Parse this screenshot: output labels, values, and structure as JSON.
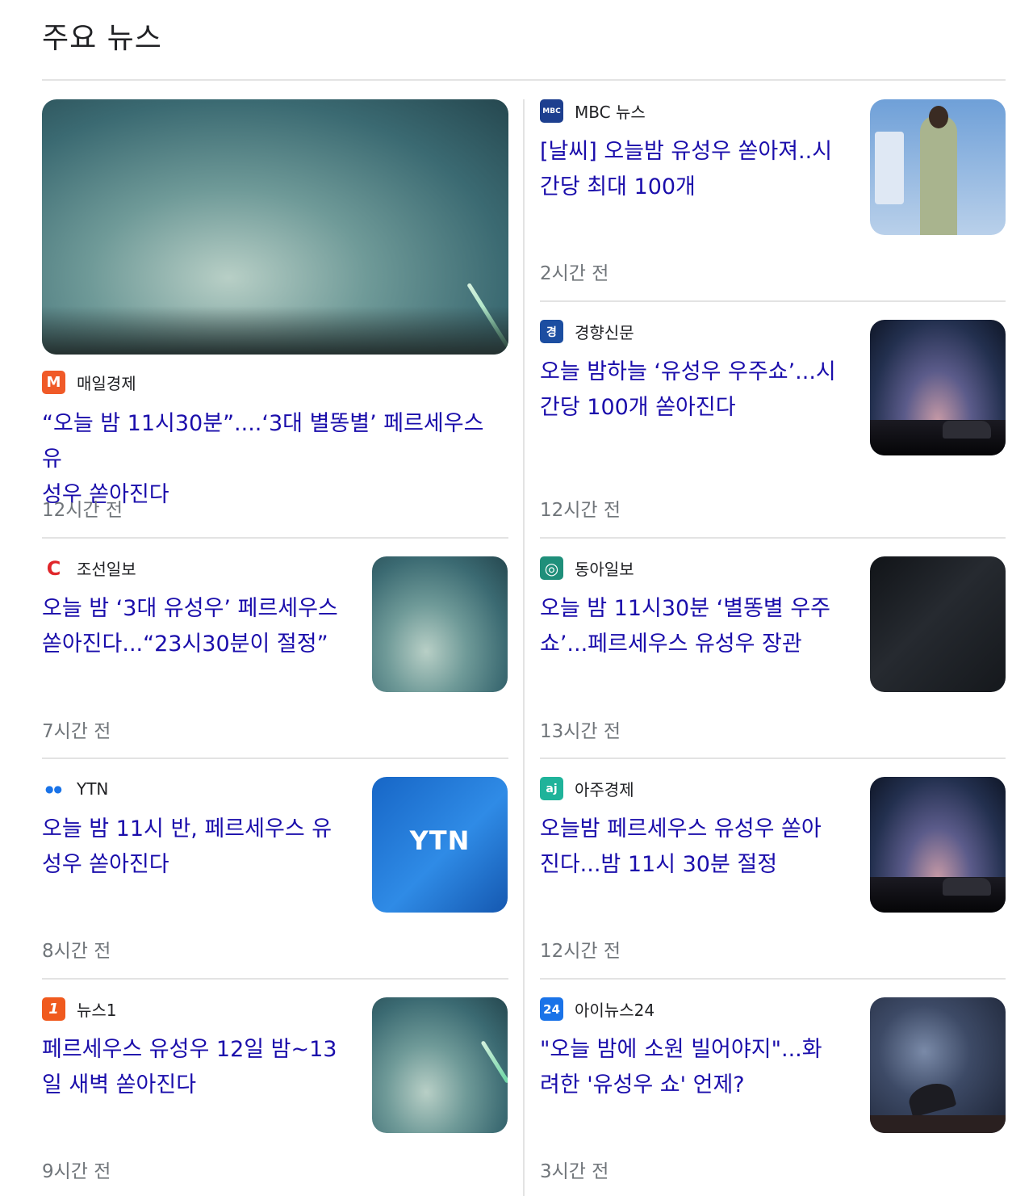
{
  "section": {
    "title": "주요 뉴스"
  },
  "articles": [
    {
      "source": "매일경제",
      "logo": "M",
      "logo_color": "#f05a28",
      "headline": "“오늘 밤 11시30분”....‘3대 별똥별’ 페르세우스 유성우 쏟아진다",
      "headline_l1": "“오늘 밤 11시30분”....‘3대 별똥별’ 페르세우스 유",
      "headline_l2": "성우 쏟아진다",
      "time": "12시간 전",
      "thumb": "meteor-sky"
    },
    {
      "source": "MBC 뉴스",
      "logo": "MBC",
      "logo_color": "#1d3f8f",
      "headline_l1": "[날씨] 오늘밤 유성우 쏟아져..시",
      "headline_l2": "간당 최대 100개",
      "time": "2시간 전",
      "thumb": "weather-broadcast"
    },
    {
      "source": "경향신문",
      "logo": "경",
      "logo_color": "#1c4ea1",
      "headline_l1": "오늘 밤하늘 ‘유성우 우주쇼’...시",
      "headline_l2": "간당 100개 쏟아진다",
      "time": "12시간 전",
      "thumb": "night-car"
    },
    {
      "source": "조선일보",
      "logo": "C",
      "logo_color": "#e0262a",
      "headline_l1": "오늘 밤 ‘3대 유성우’ 페르세우스",
      "headline_l2": "쏟아진다...“23시30분이 절정”",
      "time": "7시간 전",
      "thumb": "sky"
    },
    {
      "source": "동아일보",
      "logo": "◎",
      "logo_color": "#1f8f7a",
      "headline_l1": "오늘 밤 11시30분 ‘별똥별 우주",
      "headline_l2": "쇼’...페르세우스 유성우 장관",
      "time": "13시간 전",
      "thumb": "milky-way"
    },
    {
      "source": "YTN",
      "logo": "●●",
      "logo_color": "#ffffff",
      "headline_l1": "오늘 밤 11시 반, 페르세우스 유",
      "headline_l2": "성우 쏟아진다",
      "time": "8시간 전",
      "thumb": "ytn-logo",
      "thumb_text": "YTN"
    },
    {
      "source": "아주경제",
      "logo": "aj",
      "logo_color": "#1fb39a",
      "headline_l1": "오늘밤 페르세우스 유성우 쏟아",
      "headline_l2": "진다...밤 11시 30분 절정",
      "time": "12시간 전",
      "thumb": "night-car"
    },
    {
      "source": "뉴스1",
      "logo": "1",
      "logo_color": "#f05a1e",
      "headline_l1": "페르세우스 유성우 12일 밤~13",
      "headline_l2": "일 새벽 쏟아진다",
      "time": "9시간 전",
      "thumb": "meteor-sky"
    },
    {
      "source": "아이뉴스24",
      "logo": "24",
      "logo_color": "#1a73e8",
      "headline_l1": "\"오늘 밤에 소원 빌어야지\"...화",
      "headline_l2": "려한 '유성우 쇼' 언제?",
      "time": "3시간 전",
      "thumb": "space-dish"
    }
  ]
}
